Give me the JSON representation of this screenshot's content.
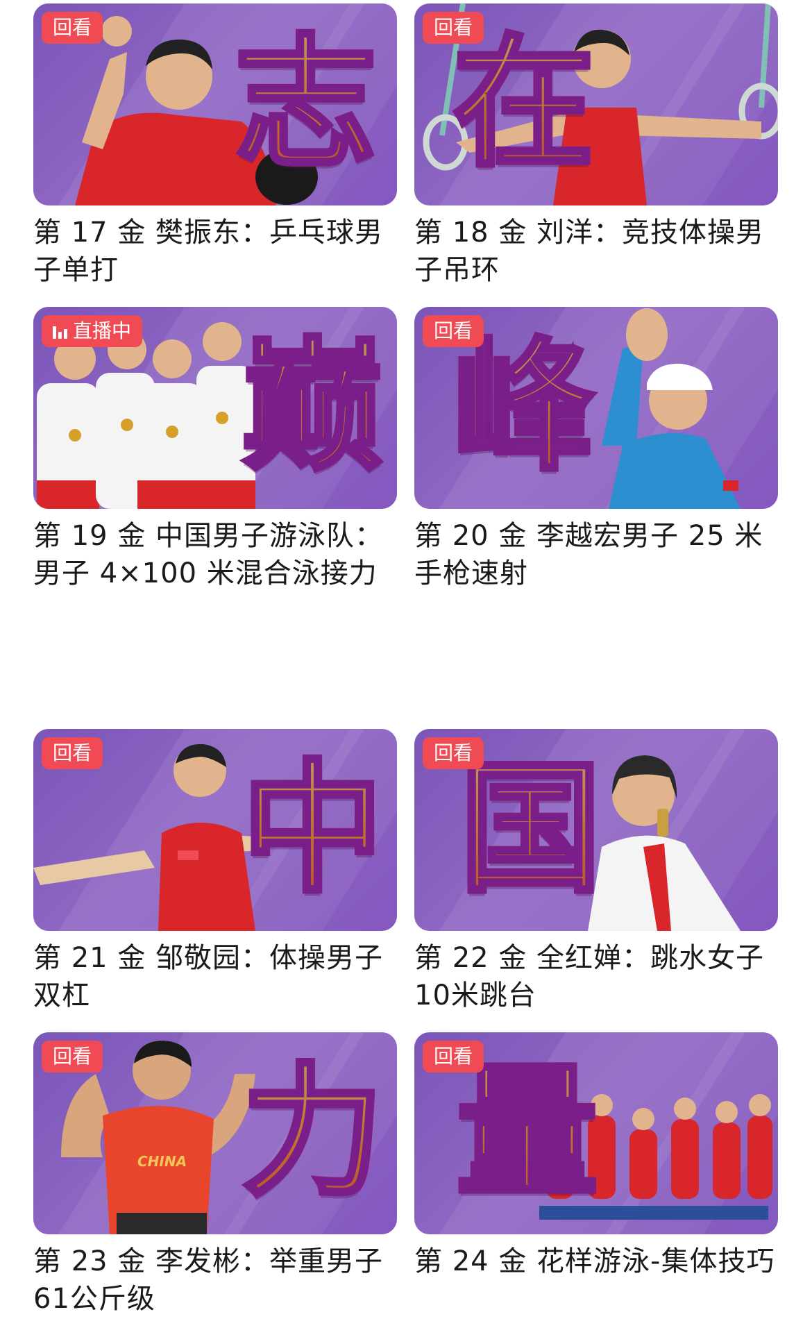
{
  "cards": [
    {
      "badge": "回看",
      "char": "志",
      "title": "第 17 金 樊振东：乒乓球男子单打"
    },
    {
      "badge": "回看",
      "char": "在",
      "title": "第 18 金 刘洋：竞技体操男子吊环"
    },
    {
      "badge": "直播中",
      "char": "巅",
      "title": "第 19 金 中国男子游泳队：男子 4×100 米混合泳接力"
    },
    {
      "badge": "回看",
      "char": "峰",
      "title": "第 20 金 李越宏男子 25 米手枪速射"
    },
    {
      "badge": "回看",
      "char": "中",
      "title": "第 21 金 邹敬园：体操男子双杠"
    },
    {
      "badge": "回看",
      "char": "国",
      "title": "第 22 金 全红婵：跳水女子10米跳台"
    },
    {
      "badge": "回看",
      "char": "力",
      "title": "第 23 金 李发彬：举重男子61公斤级"
    },
    {
      "badge": "回看",
      "char": "量",
      "title": "第 24 金 花样游泳-集体技巧"
    }
  ],
  "shirt_text": "CHINA",
  "colors": {
    "badge": "#f04b55",
    "card_bg": "#8a5fc2",
    "char_fill": "#ffb01a",
    "char_stroke": "#7a1e8a",
    "jersey_red": "#d8262a"
  }
}
